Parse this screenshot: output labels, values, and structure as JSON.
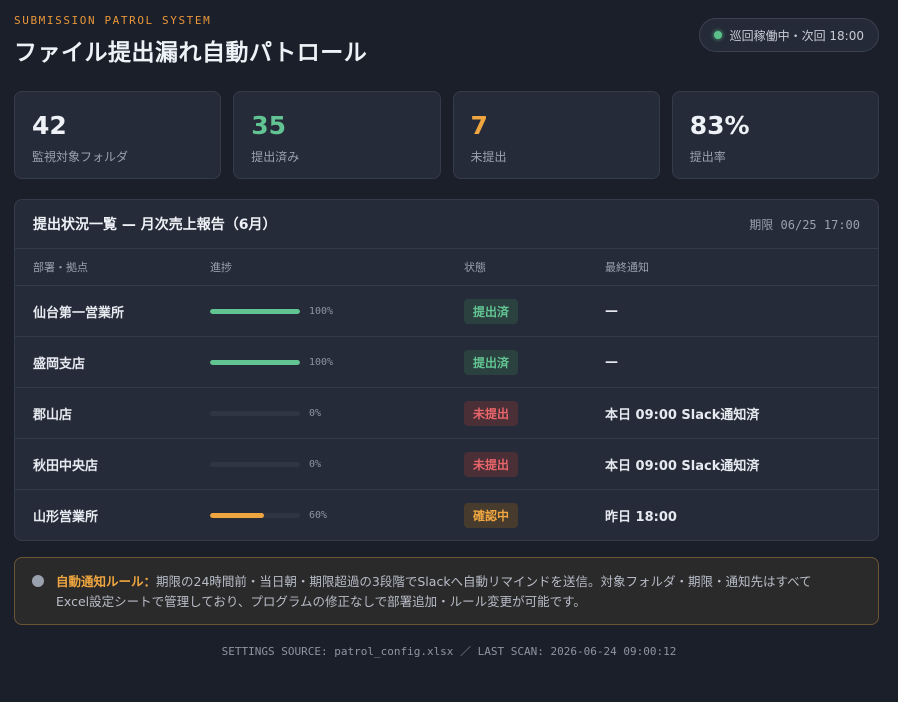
{
  "header": {
    "eyebrow": "SUBMISSION PATROL SYSTEM",
    "title": "ファイル提出漏れ自動パトロール",
    "status": "巡回稼働中・次回 18:00"
  },
  "stats": [
    {
      "value": "42",
      "label": "監視対象フォルダ",
      "color": "#eef1f6"
    },
    {
      "value": "35",
      "label": "提出済み",
      "color": "#62c492"
    },
    {
      "value": "7",
      "label": "未提出",
      "color": "#efa640"
    },
    {
      "value": "83%",
      "label": "提出率",
      "color": "#eef1f6"
    }
  ],
  "table": {
    "title": "提出状況一覧 — 月次売上報告（6月）",
    "deadline": "期限 06/25 17:00",
    "columns": [
      "部署・拠点",
      "進捗",
      "状態",
      "最終通知"
    ],
    "rows": [
      {
        "dept": "仙台第一営業所",
        "progress": 100,
        "progress_label": "100%",
        "status": "提出済",
        "status_type": "ok",
        "notice": "—"
      },
      {
        "dept": "盛岡支店",
        "progress": 100,
        "progress_label": "100%",
        "status": "提出済",
        "status_type": "ok",
        "notice": "—"
      },
      {
        "dept": "郡山店",
        "progress": 0,
        "progress_label": "0%",
        "status": "未提出",
        "status_type": "ng",
        "notice": "本日 09:00 Slack通知済"
      },
      {
        "dept": "秋田中央店",
        "progress": 0,
        "progress_label": "0%",
        "status": "未提出",
        "status_type": "ng",
        "notice": "本日 09:00 Slack通知済"
      },
      {
        "dept": "山形営業所",
        "progress": 60,
        "progress_label": "60%",
        "status": "確認中",
        "status_type": "check",
        "notice": "昨日 18:00"
      }
    ],
    "progress_colors": {
      "full": "#62c492",
      "partial": "#efa640"
    }
  },
  "rule": {
    "label": "自動通知ルール：",
    "text_line1": "期限の24時間前・当日朝・期限超過の3段階でSlackへ自動リマインドを送信。対象フォルダ・期限・通知先はすべて",
    "text_line2": "Excel設定シートで管理しており、プログラムの修正なしで部署追加・ルール変更が可能です。"
  },
  "footer": "SETTINGS SOURCE: patrol_config.xlsx ／ LAST SCAN: 2026-06-24 09:00:12"
}
